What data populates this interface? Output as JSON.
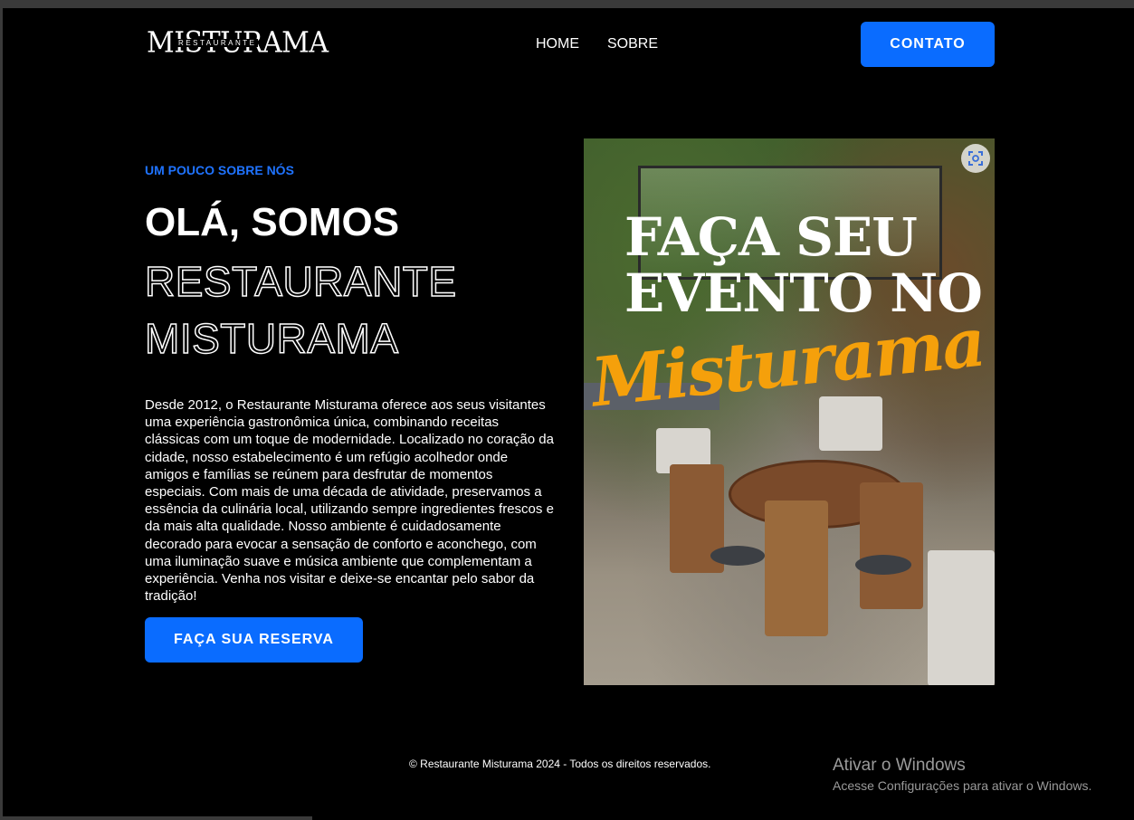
{
  "header": {
    "logo_main": "MISTURAMA",
    "logo_sub": "RESTAURANTE",
    "nav": [
      {
        "label": "HOME"
      },
      {
        "label": "SOBRE"
      }
    ],
    "contact_label": "CONTATO"
  },
  "hero": {
    "eyebrow": "UM POUCO SOBRE NÓS",
    "title_line1": "OLÁ, SOMOS",
    "title_line2": "RESTAURANTE",
    "title_line3": "MISTURAMA",
    "description": "Desde 2012, o Restaurante Misturama oferece aos seus visitantes uma experiência gastronômica única, combinando receitas clássicas com um toque de modernidade. Localizado no coração da cidade, nosso estabelecimento é um refúgio acolhedor onde amigos e famílias se reúnem para desfrutar de momentos especiais. Com mais de uma década de atividade, preservamos a essência da culinária local, utilizando sempre ingredientes frescos e da mais alta qualidade. Nosso ambiente é cuidadosamente decorado para evocar a sensação de conforto e aconchego, com uma iluminação suave e música ambiente que complementam a experiência. Venha nos visitar e deixe-se encantar pelo sabor da tradição!",
    "reserve_label": "FAÇA SUA RESERVA"
  },
  "promo": {
    "title_line1": "FAÇA SEU",
    "title_line2": "EVENTO NO",
    "script": "Misturama",
    "script_color": "#f5a00b",
    "scan_icon": "visual-search-icon"
  },
  "footer": {
    "copyright": "© Restaurante Misturama 2024 - Todos os direitos reservados."
  },
  "watermark": {
    "title": "Ativar o Windows",
    "subtitle": "Acesse Configurações para ativar o Windows."
  },
  "colors": {
    "accent": "#0a6cff",
    "eyebrow": "#1f73ff",
    "background": "#000000"
  }
}
